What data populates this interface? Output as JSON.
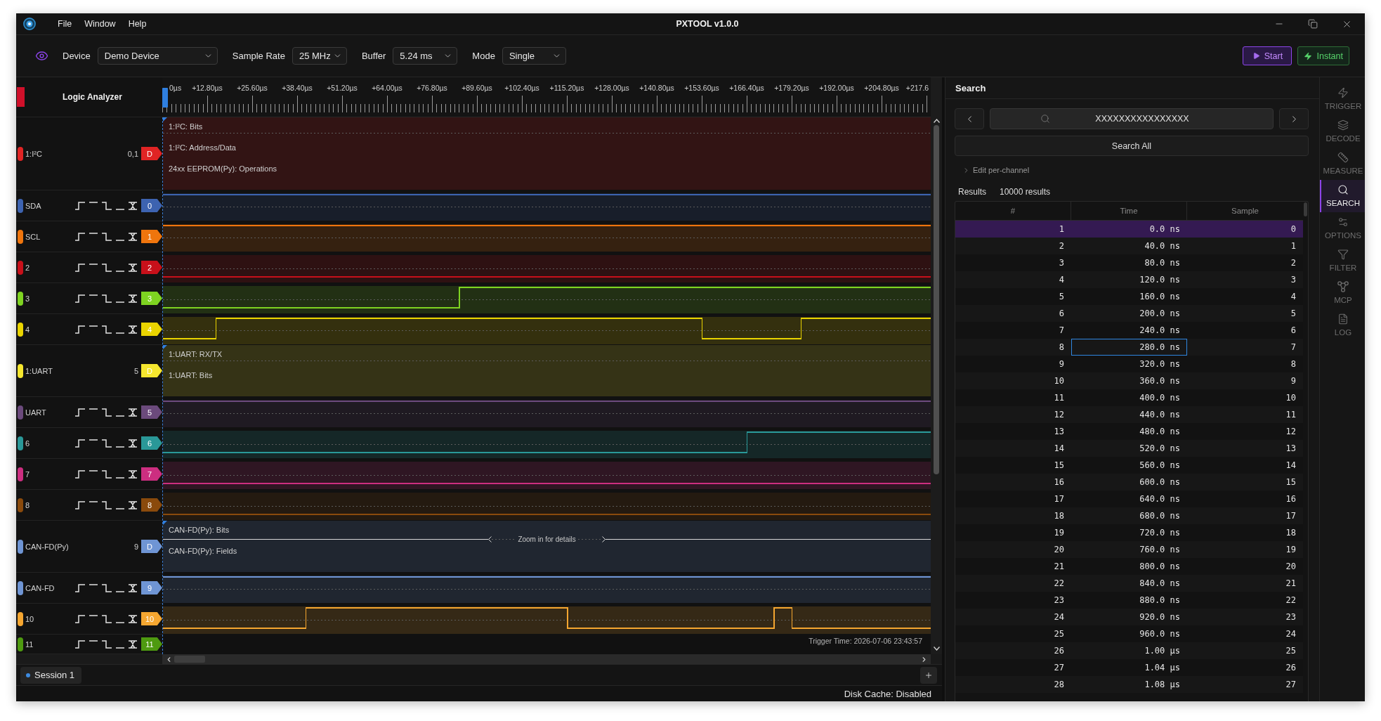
{
  "window": {
    "title": "PXTOOL v1.0.0"
  },
  "menu": [
    "File",
    "Window",
    "Help"
  ],
  "toolbar": {
    "fields": [
      {
        "label": "Device",
        "value": "Demo Device"
      },
      {
        "label": "Sample Rate",
        "value": "25 MHz"
      },
      {
        "label": "Buffer",
        "value": "5.24 ms"
      },
      {
        "label": "Mode",
        "value": "Single"
      }
    ],
    "actions": [
      {
        "label": "Start",
        "kind": "primary"
      },
      {
        "label": "Instant",
        "kind": "quick"
      }
    ]
  },
  "analyzer": {
    "title": "Logic Analyzer",
    "ruler": [
      "0µs",
      "+12.80µs",
      "+25.60µs",
      "+38.40µs",
      "+51.20µs",
      "+64.00µs",
      "+76.80µs",
      "+89.60µs",
      "+102.40µs",
      "+115.20µs",
      "+128.00µs",
      "+140.80µs",
      "+153.60µs",
      "+166.40µs",
      "+179.20µs",
      "+192.00µs",
      "+204.80µs",
      "+217.6"
    ],
    "channels": [
      {
        "kind": "decoder",
        "name": "1:I²C",
        "sources": "0,1",
        "tag": "D",
        "color": "#e02424",
        "annotations": [
          {
            "label": "1:I²C: Bits"
          },
          {
            "label": "1:I²C: Address/Data"
          },
          {
            "label": "24xx EEPROM(Py): Operations"
          }
        ]
      },
      {
        "kind": "digital",
        "name": "SDA",
        "tag": "0",
        "color": "#3d63b0"
      },
      {
        "kind": "digital",
        "name": "SCL",
        "tag": "1",
        "color": "#ef750d"
      },
      {
        "kind": "digital",
        "name": "2",
        "tag": "2",
        "color": "#c8101a"
      },
      {
        "kind": "digital",
        "name": "3",
        "tag": "3",
        "color": "#7ed321"
      },
      {
        "kind": "digital",
        "name": "4",
        "tag": "4",
        "color": "#ead400"
      },
      {
        "kind": "decoder",
        "name": "1:UART",
        "sources": "5",
        "tag": "D",
        "color": "#f5e62e",
        "annotations": [
          {
            "label": "1:UART: RX/TX"
          },
          {
            "label": "1:UART: Bits"
          }
        ]
      },
      {
        "kind": "digital",
        "name": "UART",
        "tag": "5",
        "color": "#6b4a7c"
      },
      {
        "kind": "digital",
        "name": "6",
        "tag": "6",
        "color": "#2a9898"
      },
      {
        "kind": "digital",
        "name": "7",
        "tag": "7",
        "color": "#cc2e80"
      },
      {
        "kind": "digital",
        "name": "8",
        "tag": "8",
        "color": "#8a4a0c"
      },
      {
        "kind": "decoder",
        "name": "CAN-FD(Py)",
        "sources": "9",
        "tag": "D",
        "color": "#6f95d4",
        "annotations": [
          {
            "label": "CAN-FD(Py): Bits",
            "note": "Zoom in for details"
          },
          {
            "label": "CAN-FD(Py): Fields"
          }
        ]
      },
      {
        "kind": "digital",
        "name": "CAN-FD",
        "tag": "9",
        "color": "#6f95d4"
      },
      {
        "kind": "digital",
        "name": "10",
        "tag": "10",
        "color": "#f5a630"
      },
      {
        "kind": "digital",
        "name": "11",
        "tag": "11",
        "color": "#4e9a10"
      }
    ],
    "trigger_time": "Trigger Time: 2026-07-06 23:43:57"
  },
  "sessions": [
    {
      "label": "Session 1",
      "selected": true
    }
  ],
  "status_bar": {
    "text": "Disk Cache: Disabled"
  },
  "search": {
    "title": "Search",
    "query": "XXXXXXXXXXXXXXXX",
    "search_all": "Search All",
    "per_channel": {
      "label": "Edit per-channel",
      "expanded": false
    },
    "results_label": "Results",
    "results_count": "10000 results",
    "table": {
      "columns": [
        "#",
        "Time",
        "Sample"
      ],
      "rows": [
        {
          "index": "1",
          "time": "0.0 ns",
          "sample": "0",
          "selected": true,
          "time_focused": false
        },
        {
          "index": "2",
          "time": "40.0 ns",
          "sample": "1",
          "selected": false,
          "time_focused": false
        },
        {
          "index": "3",
          "time": "80.0 ns",
          "sample": "2",
          "selected": false,
          "time_focused": false
        },
        {
          "index": "4",
          "time": "120.0 ns",
          "sample": "3",
          "selected": false,
          "time_focused": false
        },
        {
          "index": "5",
          "time": "160.0 ns",
          "sample": "4",
          "selected": false,
          "time_focused": false
        },
        {
          "index": "6",
          "time": "200.0 ns",
          "sample": "5",
          "selected": false,
          "time_focused": false
        },
        {
          "index": "7",
          "time": "240.0 ns",
          "sample": "6",
          "selected": false,
          "time_focused": false
        },
        {
          "index": "8",
          "time": "280.0 ns",
          "sample": "7",
          "selected": false,
          "time_focused": true
        },
        {
          "index": "9",
          "time": "320.0 ns",
          "sample": "8",
          "selected": false,
          "time_focused": false
        },
        {
          "index": "10",
          "time": "360.0 ns",
          "sample": "9",
          "selected": false,
          "time_focused": false
        },
        {
          "index": "11",
          "time": "400.0 ns",
          "sample": "10",
          "selected": false,
          "time_focused": false
        },
        {
          "index": "12",
          "time": "440.0 ns",
          "sample": "11",
          "selected": false,
          "time_focused": false
        },
        {
          "index": "13",
          "time": "480.0 ns",
          "sample": "12",
          "selected": false,
          "time_focused": false
        },
        {
          "index": "14",
          "time": "520.0 ns",
          "sample": "13",
          "selected": false,
          "time_focused": false
        },
        {
          "index": "15",
          "time": "560.0 ns",
          "sample": "14",
          "selected": false,
          "time_focused": false
        },
        {
          "index": "16",
          "time": "600.0 ns",
          "sample": "15",
          "selected": false,
          "time_focused": false
        },
        {
          "index": "17",
          "time": "640.0 ns",
          "sample": "16",
          "selected": false,
          "time_focused": false
        },
        {
          "index": "18",
          "time": "680.0 ns",
          "sample": "17",
          "selected": false,
          "time_focused": false
        },
        {
          "index": "19",
          "time": "720.0 ns",
          "sample": "18",
          "selected": false,
          "time_focused": false
        },
        {
          "index": "20",
          "time": "760.0 ns",
          "sample": "19",
          "selected": false,
          "time_focused": false
        },
        {
          "index": "21",
          "time": "800.0 ns",
          "sample": "20",
          "selected": false,
          "time_focused": false
        },
        {
          "index": "22",
          "time": "840.0 ns",
          "sample": "21",
          "selected": false,
          "time_focused": false
        },
        {
          "index": "23",
          "time": "880.0 ns",
          "sample": "22",
          "selected": false,
          "time_focused": false
        },
        {
          "index": "24",
          "time": "920.0 ns",
          "sample": "23",
          "selected": false,
          "time_focused": false
        },
        {
          "index": "25",
          "time": "960.0 ns",
          "sample": "24",
          "selected": false,
          "time_focused": false
        },
        {
          "index": "26",
          "time": "1.00 µs",
          "sample": "25",
          "selected": false,
          "time_focused": false
        },
        {
          "index": "27",
          "time": "1.04 µs",
          "sample": "26",
          "selected": false,
          "time_focused": false
        },
        {
          "index": "28",
          "time": "1.08 µs",
          "sample": "27",
          "selected": false,
          "time_focused": false
        }
      ]
    }
  },
  "sidebar": {
    "items": [
      {
        "label": "TRIGGER",
        "selected": false
      },
      {
        "label": "DECODE",
        "selected": false
      },
      {
        "label": "MEASURE",
        "selected": false
      },
      {
        "label": "SEARCH",
        "selected": true
      },
      {
        "label": "OPTIONS",
        "selected": false
      },
      {
        "label": "FILTER",
        "selected": false
      },
      {
        "label": "MCP",
        "selected": false
      },
      {
        "label": "LOG",
        "selected": false
      }
    ]
  }
}
